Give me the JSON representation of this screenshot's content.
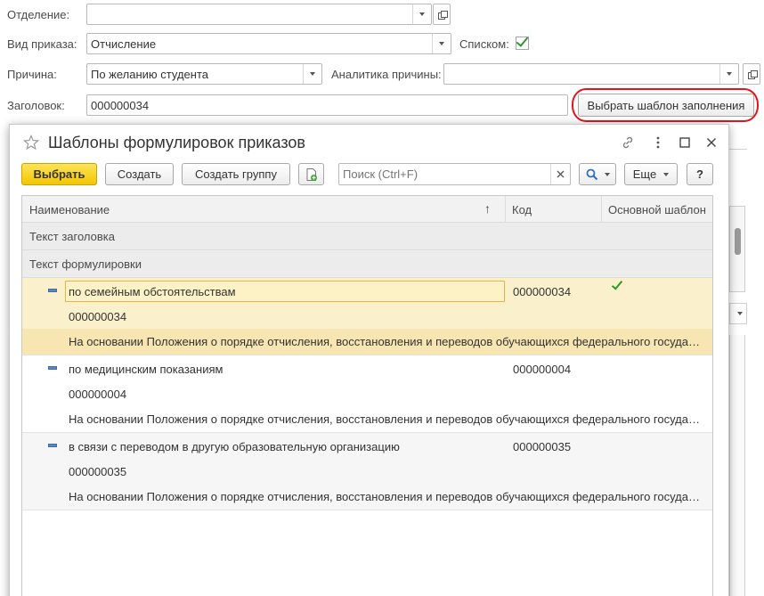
{
  "form": {
    "department_label": "Отделение:",
    "department_value": "",
    "order_type_label": "Вид приказа:",
    "order_type_value": "Отчисление",
    "list_label": "Списком:",
    "list_checked": true,
    "reason_label": "Причина:",
    "reason_value": "По желанию студента",
    "reason_analytics_label": "Аналитика причины:",
    "reason_analytics_value": "",
    "heading_label": "Заголовок:",
    "heading_value": "000000034",
    "choose_template_button": "Выбрать шаблон заполнения"
  },
  "modal": {
    "title": "Шаблоны формулировок приказов",
    "toolbar": {
      "select_label": "Выбрать",
      "create_label": "Создать",
      "create_group_label": "Создать группу",
      "search_placeholder": "Поиск (Ctrl+F)",
      "more_label": "Еще",
      "help_label": "?"
    },
    "columns": {
      "name": "Наименование",
      "sort_indicator": "↑",
      "code": "Код",
      "default": "Основной шаблон"
    },
    "subheaders": [
      "Текст заголовка",
      "Текст формулировки"
    ],
    "rows": [
      {
        "name": "по семейным обстоятельствам",
        "code": "000000034",
        "heading": "000000034",
        "text": "На основании Положения о порядке отчисления, восстановления и переводов обучающихся федерального государственного образовательного учреждения",
        "is_default": true,
        "selected": true
      },
      {
        "name": "по медицинским показаниям",
        "code": "000000004",
        "heading": "000000004",
        "text": "На основании Положения о порядке отчисления, восстановления и переводов обучающихся федерального государственного образовательного учреждения",
        "is_default": false,
        "selected": false
      },
      {
        "name": "в связи с переводом в другую образовательную организацию",
        "code": "000000035",
        "heading": "000000035",
        "text": "На основании Положения о порядке отчисления, восстановления и переводов обучающихся федерального государственного образовательного учреждения",
        "is_default": false,
        "selected": false
      }
    ]
  },
  "icons": {
    "favorite": "star-icon",
    "link": "link-icon",
    "menu": "more-vertical-icon",
    "maximize": "maximize-icon",
    "close": "close-icon",
    "search": "search-icon",
    "add_copy": "add-copy-icon"
  },
  "colors": {
    "primary_button": "#f2c600",
    "selected_row": "#fbf0cc",
    "highlight_oval": "#e3141b",
    "check": "#2a9a2a",
    "search_icon": "#2f6fc4"
  }
}
